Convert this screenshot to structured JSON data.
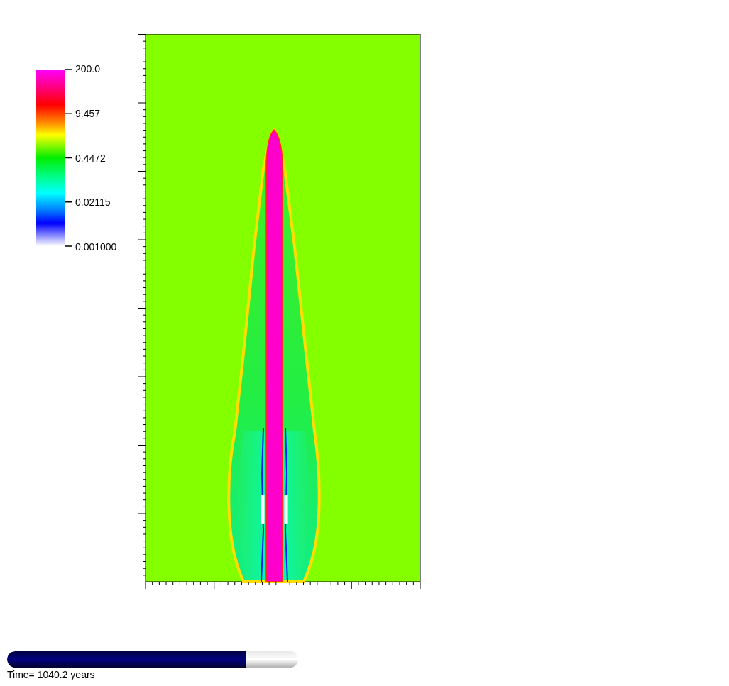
{
  "color_legend": {
    "labels": [
      "200.0",
      "9.457",
      "0.4472",
      "0.02115",
      "0.001000"
    ]
  },
  "time_progress": {
    "level": 0.82
  },
  "time_label": "Time= 1040.2 years"
}
